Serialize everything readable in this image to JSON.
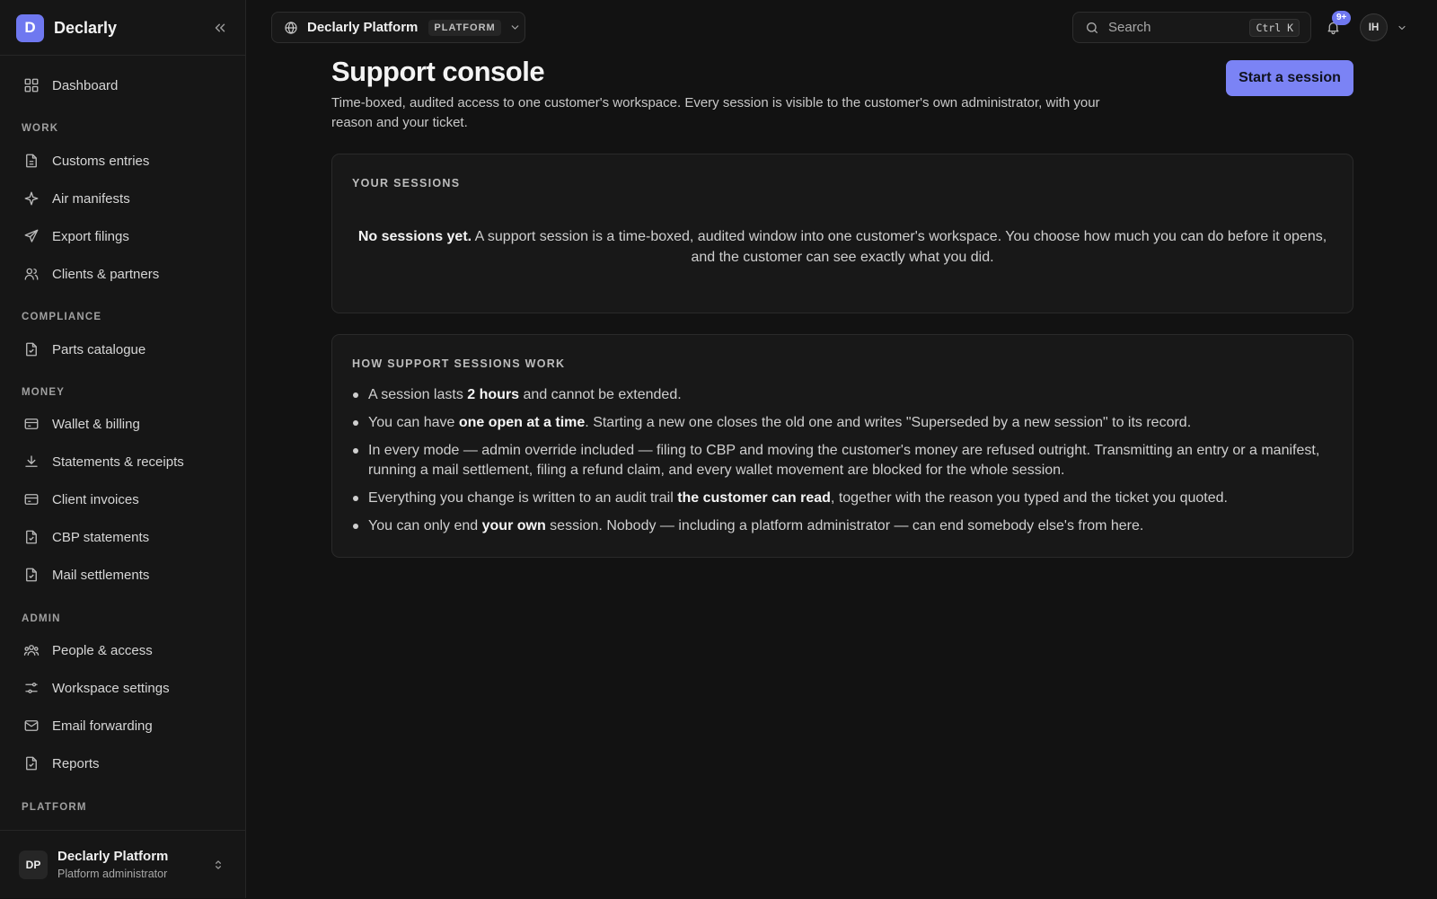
{
  "app": {
    "brand_initial": "D",
    "brand_name": "Declarly"
  },
  "sidebar": {
    "top_item": {
      "label": "Dashboard",
      "icon": "grid-icon"
    },
    "sections": [
      {
        "title": "WORK",
        "items": [
          {
            "label": "Customs entries",
            "icon": "document-icon"
          },
          {
            "label": "Air manifests",
            "icon": "sparkle-icon"
          },
          {
            "label": "Export filings",
            "icon": "send-icon"
          },
          {
            "label": "Clients & partners",
            "icon": "users-icon"
          }
        ]
      },
      {
        "title": "COMPLIANCE",
        "items": [
          {
            "label": "Parts catalogue",
            "icon": "file-check-icon"
          }
        ]
      },
      {
        "title": "MONEY",
        "items": [
          {
            "label": "Wallet & billing",
            "icon": "card-icon"
          },
          {
            "label": "Statements & receipts",
            "icon": "download-icon"
          },
          {
            "label": "Client invoices",
            "icon": "card-icon"
          },
          {
            "label": "CBP statements",
            "icon": "file-check-icon"
          },
          {
            "label": "Mail settlements",
            "icon": "file-check-icon"
          }
        ]
      },
      {
        "title": "ADMIN",
        "items": [
          {
            "label": "People & access",
            "icon": "people-icon"
          },
          {
            "label": "Workspace settings",
            "icon": "sliders-icon"
          },
          {
            "label": "Email forwarding",
            "icon": "mail-icon"
          },
          {
            "label": "Reports",
            "icon": "file-check-icon"
          }
        ]
      },
      {
        "title": "PLATFORM",
        "items": []
      }
    ],
    "footer": {
      "initials": "DP",
      "name": "Declarly Platform",
      "role": "Platform administrator"
    }
  },
  "topbar": {
    "workspace": {
      "name": "Declarly Platform",
      "badge": "PLATFORM"
    },
    "search": {
      "placeholder": "Search",
      "shortcut": "Ctrl K"
    },
    "notifications": {
      "count": "9+"
    },
    "user": {
      "initials": "IH"
    }
  },
  "main": {
    "title": "Support console",
    "description": "Time-boxed, audited access to one customer's workspace. Every session is visible to the customer's own administrator, with your reason and your ticket.",
    "primary_action": "Start a session",
    "sessions_card": {
      "title": "YOUR SESSIONS",
      "empty_bold": "No sessions yet.",
      "empty_text": " A support session is a time-boxed, audited window into one customer's workspace. You choose how much you can do before it opens, and the customer can see exactly what you did."
    },
    "how_card": {
      "title": "HOW SUPPORT SESSIONS WORK",
      "bullets": [
        {
          "pre": "A session lasts ",
          "bold": "2 hours",
          "post": " and cannot be extended."
        },
        {
          "pre": "You can have ",
          "bold": "one open at a time",
          "post": ". Starting a new one closes the old one and writes \"Superseded by a new session\" to its record."
        },
        {
          "pre": "In every mode — admin override included — filing to CBP and moving the customer's money are refused outright. Transmitting an entry or a manifest, running a mail settlement, filing a refund claim, and every wallet movement are blocked for the whole session.",
          "bold": "",
          "post": ""
        },
        {
          "pre": "Everything you change is written to an audit trail ",
          "bold": "the customer can read",
          "post": ", together with the reason you typed and the ticket you quoted."
        },
        {
          "pre": "You can only end ",
          "bold": "your own",
          "post": " session. Nobody — including a platform administrator — can end somebody else's from here."
        }
      ]
    }
  },
  "colors": {
    "accent": "#7b83f5",
    "background": "#121212",
    "sidebar": "#161616",
    "card": "#181818"
  }
}
